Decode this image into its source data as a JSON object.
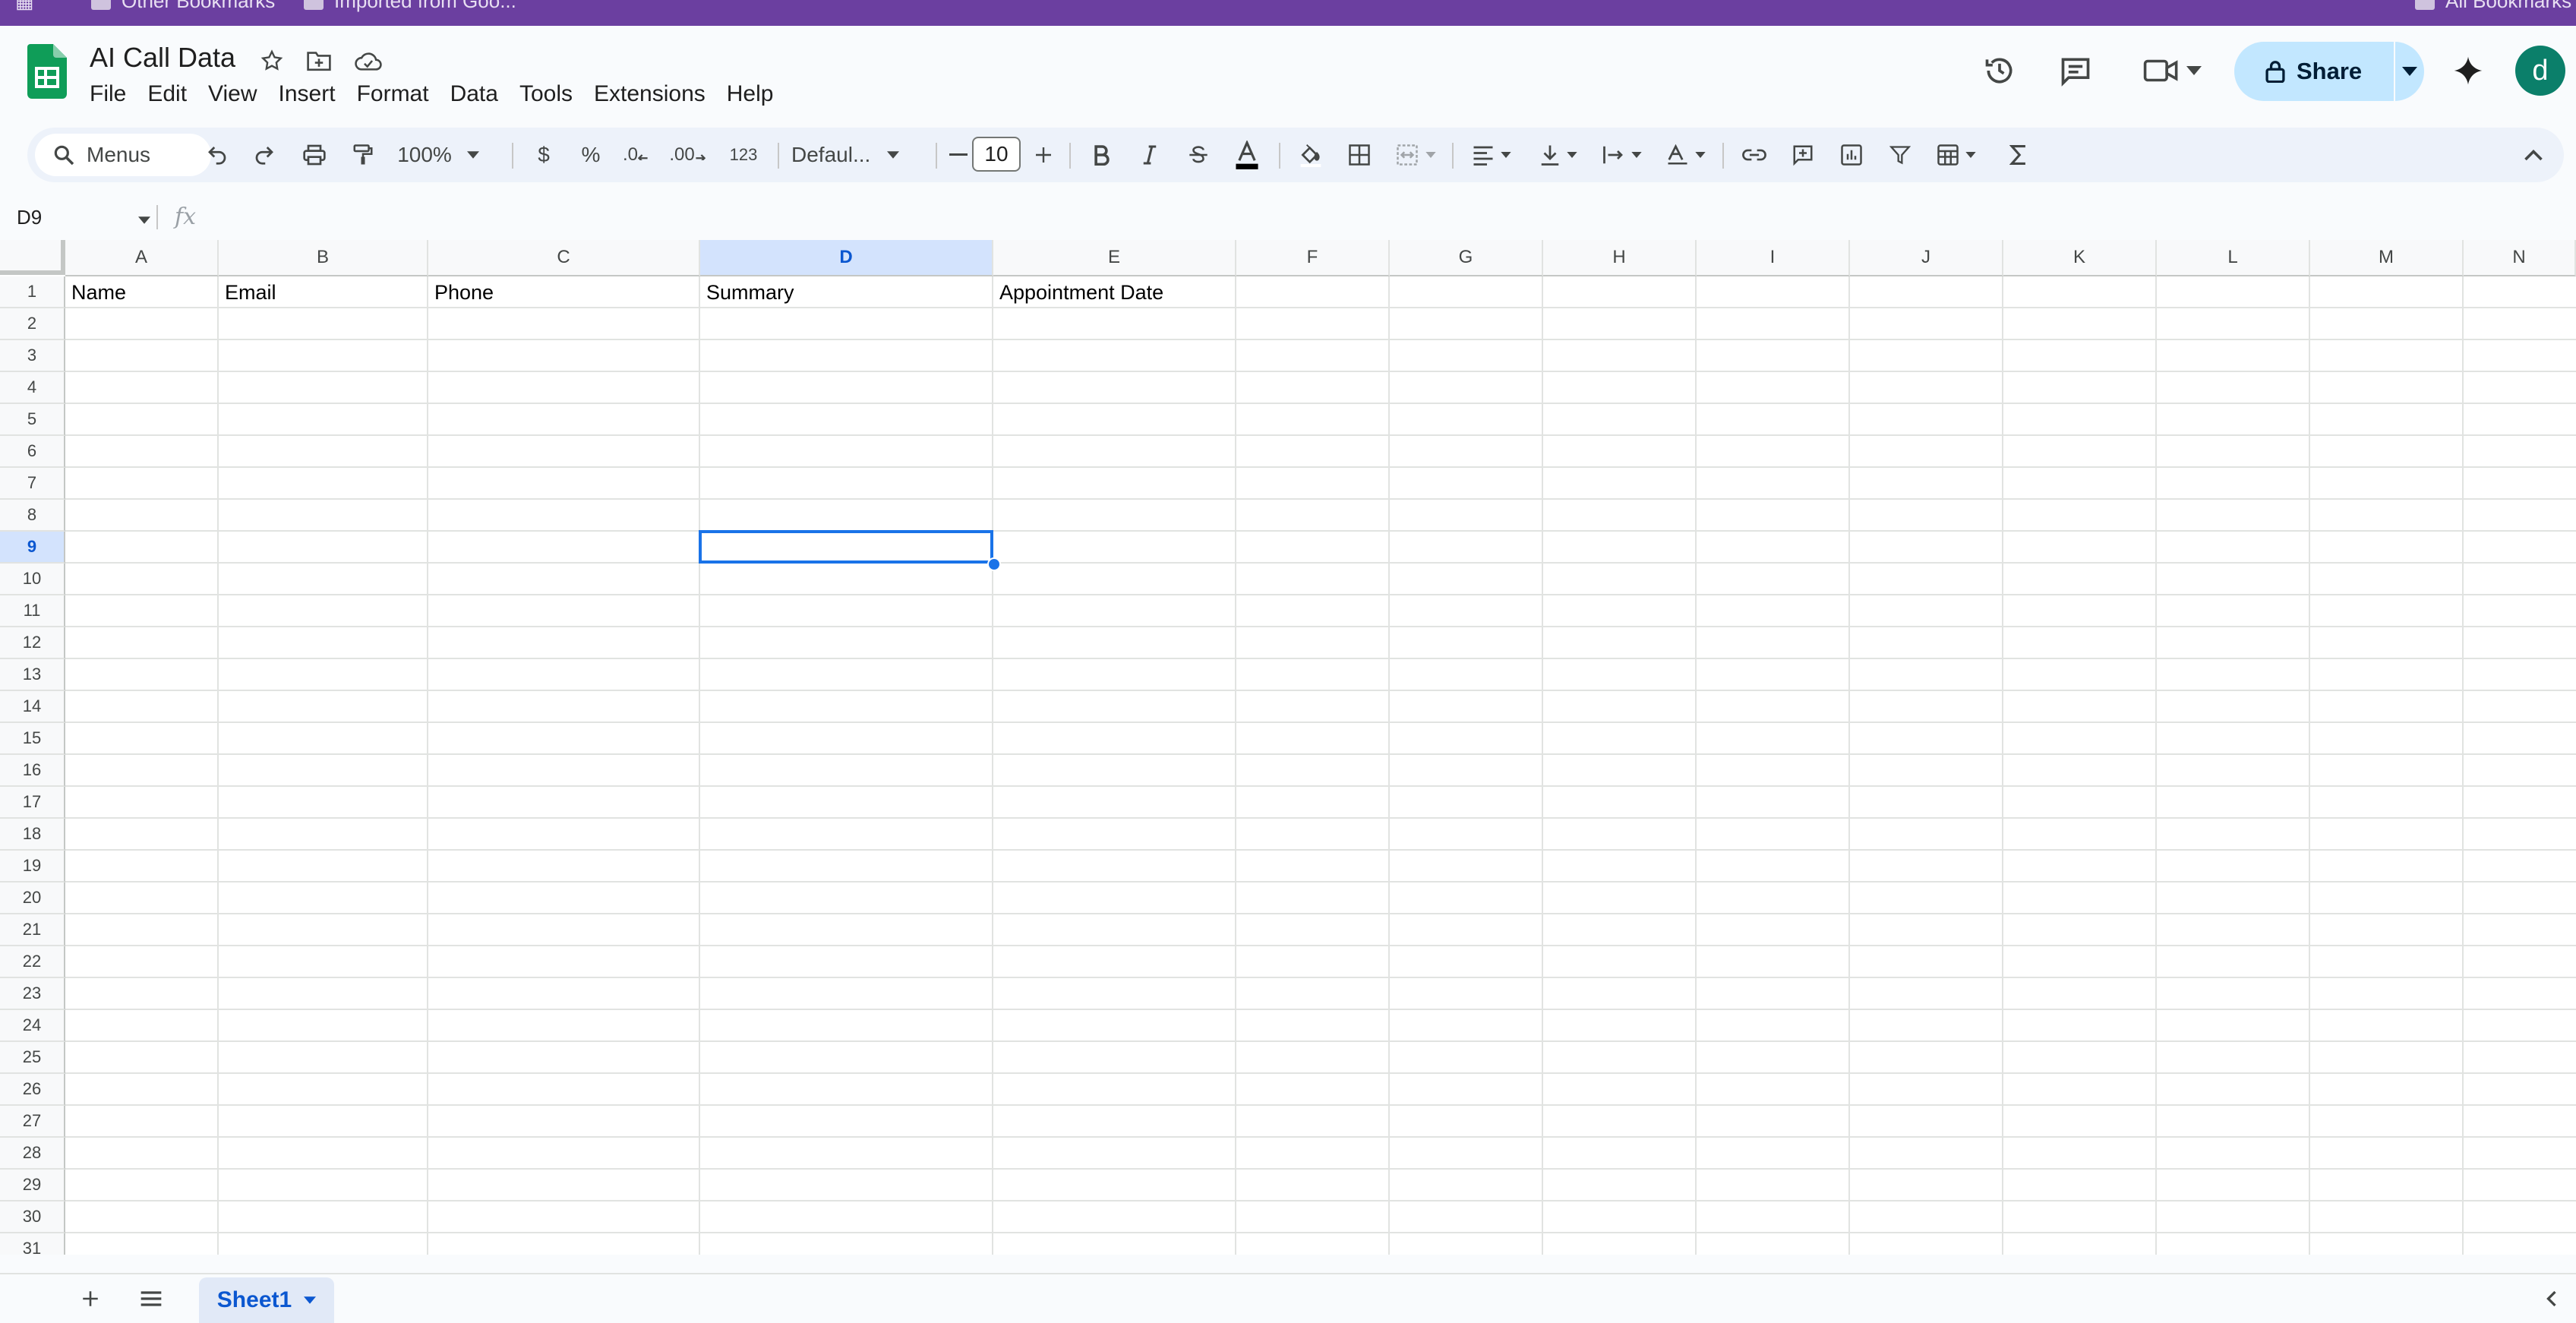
{
  "bookmarks": [
    "Other Bookmarks",
    "Imported from Goo..."
  ],
  "bookmarks_right": "All Bookmarks",
  "document": {
    "title": "AI Call Data"
  },
  "menu": [
    "File",
    "Edit",
    "View",
    "Insert",
    "Format",
    "Data",
    "Tools",
    "Extensions",
    "Help"
  ],
  "share": {
    "label": "Share"
  },
  "avatar": {
    "initial": "d",
    "color": "#0b7f6a"
  },
  "toolbar": {
    "menus_label": "Menus",
    "zoom": "100%",
    "currency": "$",
    "percent": "%",
    "decrease_decimal": ".0",
    "increase_decimal": ".00",
    "number_format": "123",
    "font": "Defaul...",
    "font_size": "10"
  },
  "formula_bar": {
    "name_box": "D9",
    "fx_label": "fx",
    "value": ""
  },
  "grid": {
    "columns": [
      {
        "label": "A"
      },
      {
        "label": "B"
      },
      {
        "label": "C"
      },
      {
        "label": "D"
      },
      {
        "label": "E"
      },
      {
        "label": "F"
      },
      {
        "label": "G"
      },
      {
        "label": "H"
      },
      {
        "label": "I"
      },
      {
        "label": "J"
      },
      {
        "label": "K"
      },
      {
        "label": "L"
      },
      {
        "label": "M"
      },
      {
        "label": "N"
      }
    ],
    "row_count": 31,
    "header_row": [
      "Name",
      "Email",
      "Phone",
      "Summary",
      "Appointment Date"
    ],
    "selected_column": "D",
    "selected_row": 9,
    "accent_color": "#1a73e8"
  },
  "sheets": [
    {
      "name": "Sheet1",
      "active": true
    }
  ]
}
